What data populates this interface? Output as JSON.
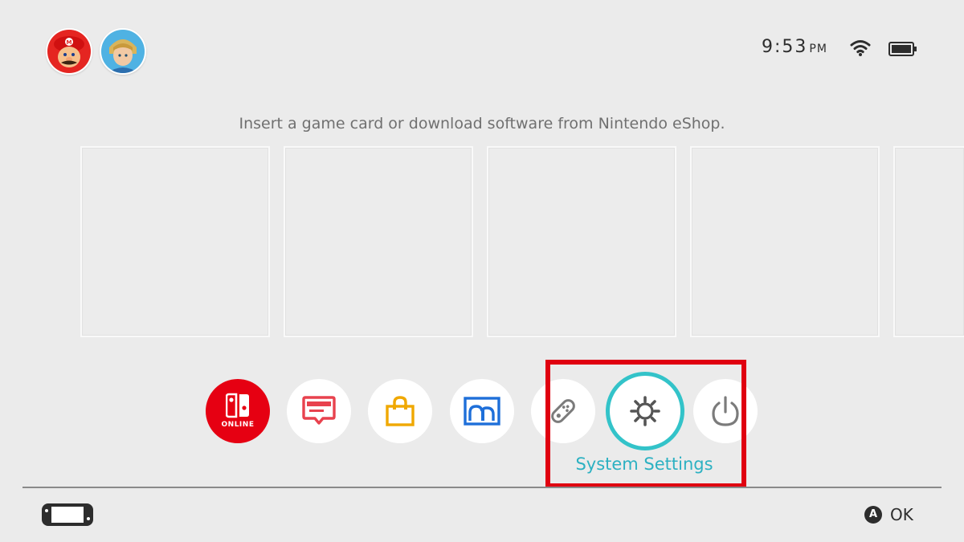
{
  "users": [
    {
      "icon": "mario-avatar-icon"
    },
    {
      "icon": "link-avatar-icon"
    }
  ],
  "status": {
    "time": "9:53",
    "time_suffix": "PM",
    "wifi_icon": "wifi-icon",
    "battery_icon": "battery-icon"
  },
  "message": "Insert a game card or download software from Nintendo eShop.",
  "dock": {
    "items": [
      {
        "icon": "nintendo-switch-online-icon",
        "label": "ONLINE"
      },
      {
        "icon": "news-icon"
      },
      {
        "icon": "eshop-bag-icon"
      },
      {
        "icon": "album-icon"
      },
      {
        "icon": "controllers-icon"
      },
      {
        "icon": "gear-icon"
      },
      {
        "icon": "power-icon"
      }
    ],
    "selected_label": "System Settings"
  },
  "footer": {
    "console_icon": "handheld-console-icon",
    "a_button": "A",
    "ok_label": "OK"
  },
  "colors": {
    "background": "#ebebeb",
    "online_red": "#e60012",
    "selection_teal": "#33c3c9",
    "highlight_red": "#e00010",
    "label_teal": "#2cb1c2"
  }
}
